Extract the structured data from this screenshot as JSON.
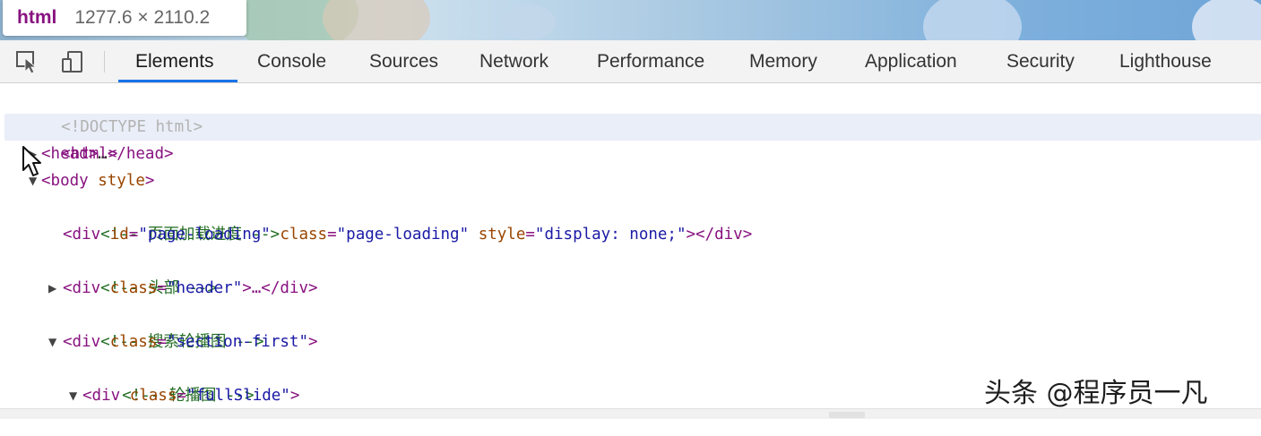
{
  "tooltip": {
    "tag": "html",
    "dims": "1277.6 × 2110.2"
  },
  "toolbar": {
    "icons": [
      "inspect-element-icon",
      "device-toolbar-icon"
    ],
    "tabs": [
      "Elements",
      "Console",
      "Sources",
      "Network",
      "Performance",
      "Memory",
      "Application",
      "Security",
      "Lighthouse"
    ],
    "active_tab": "Elements"
  },
  "dom": {
    "doctype": "<!DOCTYPE html>",
    "html_tag": "<html>",
    "head_open": "<head>",
    "head_ellipsis": "…",
    "head_close": "</head>",
    "body_open": "<body",
    "body_attr": "style",
    "body_end": ">",
    "comment_loading": "<!-- 页面加载进度 -->",
    "div_open": "<div",
    "attr_id": "id",
    "val_loading_id": "\"page-loading\"",
    "attr_class": "class",
    "val_loading_class": "\"page-loading\"",
    "attr_style": "style",
    "val_style": "\"display: none;\"",
    "div_end_close": "></div>",
    "comment_header": "<!-- 头部 -->",
    "val_header": "\"header\"",
    "ellipsis_close": ">…</div>",
    "comment_search": "<!-- 搜索轮播图 -->",
    "val_section": "\"section-first\"",
    "gt": ">",
    "comment_slide": "<!-- 轮播图 -->",
    "val_fullslide": "\"fullSlide\"",
    "eq": "="
  },
  "watermark": "头条 @程序员一凡",
  "colors": {
    "tag": "#881280",
    "attr_name": "#994500",
    "attr_value": "#1a1aa6",
    "comment": "#236e25",
    "active_tab_underline": "#1a73e8",
    "selected_row": "#e9eef8"
  }
}
